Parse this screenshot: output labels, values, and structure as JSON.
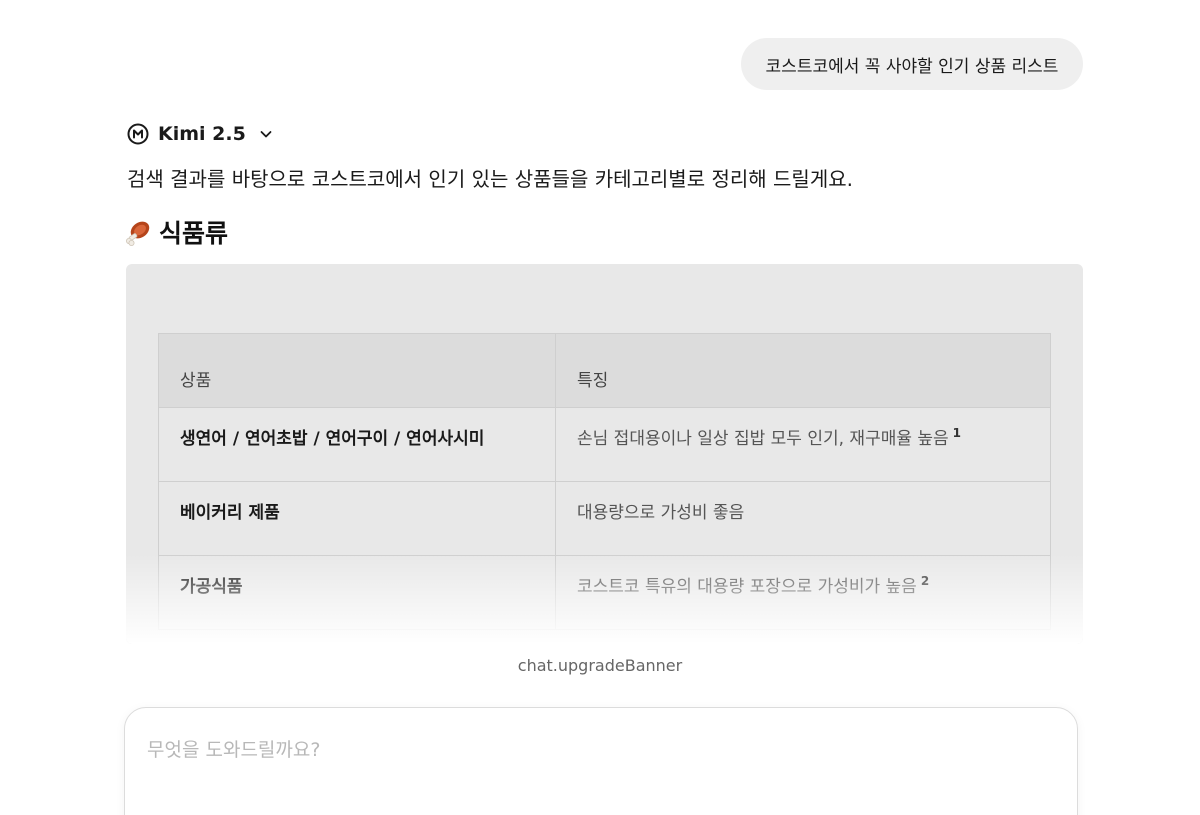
{
  "conversation": {
    "user_message": "코스트코에서 꼭 사야할 인기 상품 리스트",
    "model": {
      "name": "Kimi 2.5",
      "icon": "kimi-logo-icon",
      "dropdown_icon": "chevron-down-icon"
    },
    "response": {
      "intro": "검색 결과를 바탕으로 코스트코에서 인기 있는 상품들을 카테고리별로 정리해 드릴게요.",
      "section": {
        "emoji_icon": "meat-on-bone-icon",
        "title": "식품류"
      },
      "table": {
        "headers": [
          "상품",
          "특징"
        ],
        "rows": [
          {
            "product": "생연어 / 연어초밥 / 연어구이 / 연어사시미",
            "feature": "손님 접대용이나 일상 집밥 모두 인기, 재구매율 높음",
            "citation": "1"
          },
          {
            "product": "베이커리 제품",
            "feature": "대용량으로 가성비 좋음",
            "citation": ""
          },
          {
            "product": "가공식품",
            "feature": "코스트코 특유의 대용량 포장으로 가성비가 높음",
            "citation": "2"
          }
        ]
      }
    }
  },
  "banner": {
    "text": "chat.upgradeBanner"
  },
  "composer": {
    "placeholder": "무엇을 도와드릴까요?",
    "value": ""
  }
}
